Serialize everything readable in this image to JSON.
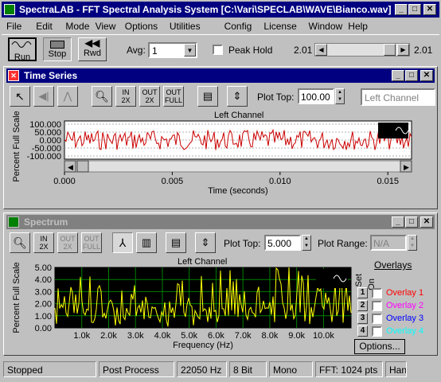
{
  "app": {
    "title": "SpectraLAB - FFT Spectral Analysis System [C:\\Vari\\SPECLAB\\WAVE\\Bianco.wav]"
  },
  "menu": [
    "File",
    "Edit",
    "Mode",
    "View",
    "Options",
    "Utilities",
    "Config",
    "License",
    "Window",
    "Help"
  ],
  "toolbar": {
    "run": "Run",
    "stop": "Stop",
    "rwd": "Rwd",
    "avg_label": "Avg:",
    "avg_value": "1",
    "peak_hold": "Peak Hold",
    "pos_left": "2.01",
    "pos_right": "2.01"
  },
  "time_series": {
    "title": "Time Series",
    "plot_top_label": "Plot Top:",
    "plot_top": "100.00",
    "channel": "Left Channel",
    "buttons": {
      "zoom_in": "IN\n2X",
      "zoom_out": "OUT\n2X",
      "full": "OUT\nFULL"
    },
    "chart_title": "Left Channel",
    "ylabel": "Percent Full Scale",
    "xlabel": "Time (seconds)",
    "yticks": [
      "100.000",
      "50.000",
      "0.000",
      "-50.000",
      "-100.000"
    ],
    "xticks": [
      "0.000",
      "0.005",
      "0.010",
      "0.015"
    ]
  },
  "spectrum": {
    "title": "Spectrum",
    "plot_top_label": "Plot Top:",
    "plot_top": "5.000",
    "plot_range_label": "Plot Range:",
    "plot_range": "N/A",
    "chart_title": "Left Channel",
    "ylabel": "Percent Full Scale",
    "xlabel": "Frequency (Hz)",
    "yticks": [
      "5.00",
      "4.00",
      "3.00",
      "2.00",
      "1.00",
      "0.00"
    ],
    "xticks": [
      "1.0k",
      "2.0k",
      "3.0k",
      "4.0k",
      "5.0k",
      "6.0k",
      "7.0k",
      "8.0k",
      "9.0k",
      "10.0k"
    ],
    "overlays_title": "Overlays",
    "set_label": "Set",
    "on_label": "On",
    "overlays": [
      {
        "num": "1",
        "name": "Overlay 1",
        "color": "#ff0000"
      },
      {
        "num": "2",
        "name": "Overlay 2",
        "color": "#ff00ff"
      },
      {
        "num": "3",
        "name": "Overlay 3",
        "color": "#0000ff"
      },
      {
        "num": "4",
        "name": "Overlay 4",
        "color": "#00ffff"
      }
    ],
    "options_button": "Options..."
  },
  "status": [
    "Stopped",
    "Post Process",
    "22050 Hz",
    "8 Bit",
    "Mono",
    "FFT: 1024 pts",
    "Han"
  ],
  "colors": {
    "title_active": "#000080",
    "time_trace": "#cc0000",
    "spectrum_trace": "#ffff00",
    "spectrum_bg": "#000000",
    "spectrum_grid": "#008000"
  }
}
